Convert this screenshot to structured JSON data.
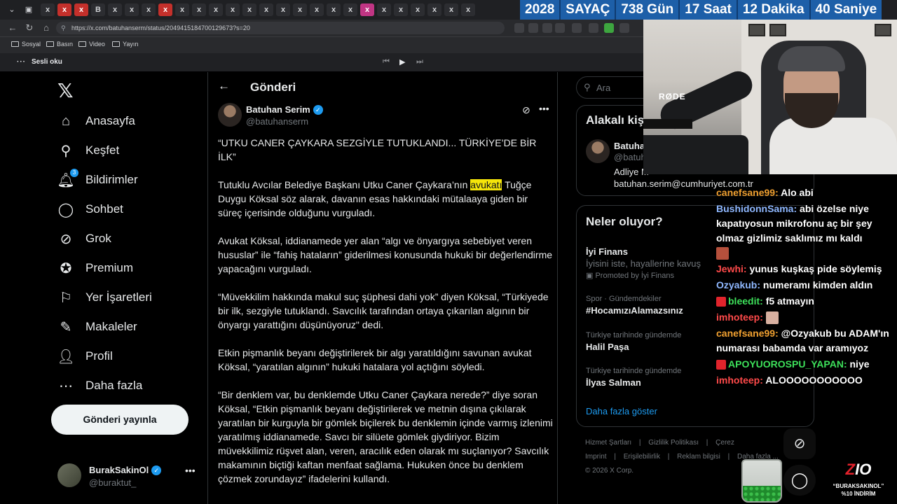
{
  "browser": {
    "tab_icons": [
      "x",
      "x",
      "x",
      "B",
      "x",
      "x",
      "x",
      "x",
      "x",
      "x",
      "x",
      "x",
      "x",
      "x",
      "x",
      "x",
      "x",
      "x",
      "x",
      "x",
      "x",
      "x",
      "x",
      "x",
      "x",
      "x"
    ],
    "url": "https://x.com/batuhanserm/status/2049415184700129673?s=20",
    "bookmarks": [
      "Sosyal",
      "Basın",
      "Video",
      "Yayın"
    ],
    "reader_label": "Sesli oku"
  },
  "countdown": [
    "2028",
    "SAYAÇ",
    "738 Gün",
    "17 Saat",
    "12 Dakika",
    "40 Saniye"
  ],
  "nav": {
    "items": [
      {
        "label": "Anasayfa",
        "icon": "home-icon"
      },
      {
        "label": "Keşfet",
        "icon": "search-icon"
      },
      {
        "label": "Bildirimler",
        "icon": "bell-icon",
        "badge": "3"
      },
      {
        "label": "Sohbet",
        "icon": "chat-icon"
      },
      {
        "label": "Grok",
        "icon": "grok-icon"
      },
      {
        "label": "Premium",
        "icon": "premium-icon"
      },
      {
        "label": "Yer İşaretleri",
        "icon": "bookmark-icon"
      },
      {
        "label": "Makaleler",
        "icon": "article-icon"
      },
      {
        "label": "Profil",
        "icon": "profile-icon"
      },
      {
        "label": "Daha fazla",
        "icon": "more-circle-icon"
      }
    ],
    "post_button": "Gönderi yayınla",
    "account": {
      "name": "BurakSakinOl",
      "handle": "@buraktut_"
    }
  },
  "post": {
    "header_title": "Gönderi",
    "author_name": "Batuhan Serim",
    "author_handle": "@batuhanserm",
    "p1": "“UTKU CANER ÇAYKARA SEZGİYLE TUTUKLANDI... TÜRKİYE’DE BİR İLK”",
    "p2_before": "Tutuklu Avcılar Belediye Başkanı Utku Caner Çaykara’nın ",
    "p2_highlight": "avukatı",
    "p2_after": " Tuğçe Duygu Köksal söz alarak, davanın esas hakkındaki mütalaaya giden bir süreç içerisinde olduğunu vurguladı.",
    "p3": "Avukat Köksal, iddianamede yer alan “algı ve önyargıya sebebiyet veren hususlar” ile “fahiş hataların” giderilmesi konusunda hukuki bir değerlendirme yapacağını vurguladı.",
    "p4": "“Müvekkilim hakkında makul suç şüphesi dahi yok” diyen Köksal, “Türkiyede bir ilk, sezgiyle tutuklandı. Savcılık tarafından ortaya çıkarılan algının bir önyargı yarattığını düşünüyoruz\" dedi.",
    "p5": "Etkin pişmanlık beyanı değiştirilerek bir algı yaratıldığını savunan avukat Köksal, “yaratılan algının” hukuki hatalara yol açtığını söyledi.",
    "p6": "“Bir denklem var, bu denklemde Utku Caner Çaykara nerede?” diye soran Köksal, “Etkin pişmanlık beyanı değiştirilerek ve metnin dışına çıkılarak yaratılan bir kurguyla bir gömlek biçilerek bu denklemin içinde varmış izlenimi yaratılmış iddianamede. Savcı bir silüete gömlek giydiriyor. Bizim müvekkilimiz rüşvet alan, veren, aracılık eden olarak mı suçlanıyor? Savcılık makamının biçtiği kaftan menfaat sağlama. Hukuken önce bu denklem çözmek zorundayız” ifadelerini kullandı."
  },
  "sidebar": {
    "search_placeholder": "Ara",
    "related_title": "Alakalı kiş",
    "related": {
      "name": "Batuha",
      "handle": "@batuh",
      "bio_1": "Adliye M",
      "bio_2": "batuhan.serim@cumhuriyet.com.tr"
    },
    "trends_title": "Neler oluyor?",
    "trends": [
      {
        "name": "İyi Finans",
        "sub": "İyisini iste, hayallerine kavuş",
        "promo": "Promoted by İyi Finans"
      },
      {
        "category": "Spor · Gündemdekiler",
        "name": "#HocamızıAlamazsınız"
      },
      {
        "category": "Türkiye tarihinde gündemde",
        "name": "Halil Paşa"
      },
      {
        "category": "Türkiye tarihinde gündemde",
        "name": "İlyas Salman"
      }
    ],
    "show_more": "Daha fazla göster",
    "footer_1": [
      "Hizmet Şartları",
      "|",
      "Gizlilik Politikası",
      "|",
      "Çerez"
    ],
    "footer_2": [
      "Imprint",
      "|",
      "Erişilebilirlik",
      "|",
      "Reklam bilgisi",
      "|",
      "Daha fazla ..."
    ],
    "footer_3": "© 2026 X Corp."
  },
  "chat": [
    {
      "user": "canefsane99",
      "color": "#f0a030",
      "text": "Alo abi"
    },
    {
      "user": "BushidonnSama",
      "color": "#8fb8ff",
      "text": "abi özelse niye kapatıyosun mikrofonu aç bir şey olmaz gizlimiz saklımız mı kaldı"
    },
    {
      "user": "Jewhi",
      "color": "#ff4a4a",
      "text": "yunus kuşkaş pide söylemiş"
    },
    {
      "user": "Ozyakub",
      "color": "#8fb8ff",
      "text": "numeramı kimden aldın"
    },
    {
      "user": "bleedit",
      "color": "#3de05a",
      "text": "f5 atmayın"
    },
    {
      "user": "imhoteep",
      "color": "#ff4a4a",
      "text": ""
    },
    {
      "user": "canefsane99",
      "color": "#f0a030",
      "text": "@Ozyakub bu ADAM'ın numarası babamda var aramıyoz"
    },
    {
      "user": "APOYUOROSPU_YAPAN",
      "color": "#3de05a",
      "text": "niye"
    },
    {
      "user": "imhoteep",
      "color": "#ff4a4a",
      "text": "ALOOOOOOOOOOO"
    }
  ],
  "promo": {
    "logo": "ZIO",
    "line1": "“BURAKSAKINOL”",
    "line2": "%10 İNDİRİM"
  }
}
